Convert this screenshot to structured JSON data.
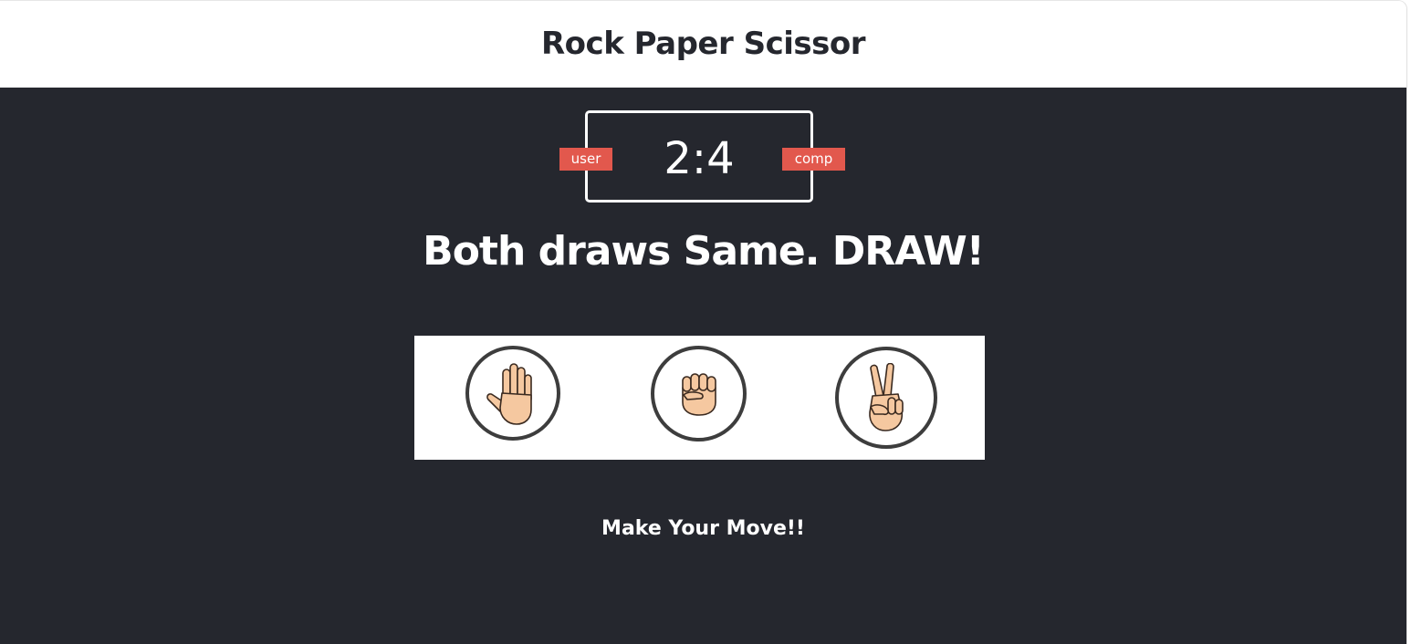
{
  "header": {
    "title": "Rock Paper Scissor"
  },
  "scoreboard": {
    "user_label": "user",
    "comp_label": "comp",
    "user_score": 2,
    "comp_score": 4,
    "score_text": "2:4"
  },
  "result": {
    "message": "Both draws Same. DRAW!"
  },
  "choices": [
    {
      "id": "paper",
      "icon": "raised-hand-icon"
    },
    {
      "id": "rock",
      "icon": "raised-fist-icon"
    },
    {
      "id": "scissors",
      "icon": "victory-hand-icon"
    }
  ],
  "prompt": {
    "message": "Make Your Move!!"
  },
  "colors": {
    "background": "#25272e",
    "header_bg": "#ffffff",
    "badge": "#e2584d",
    "text_light": "#ffffff",
    "circle_border": "#3d3d3d",
    "skin": "#f5c8a0",
    "skin_outline": "#3a2a20"
  }
}
